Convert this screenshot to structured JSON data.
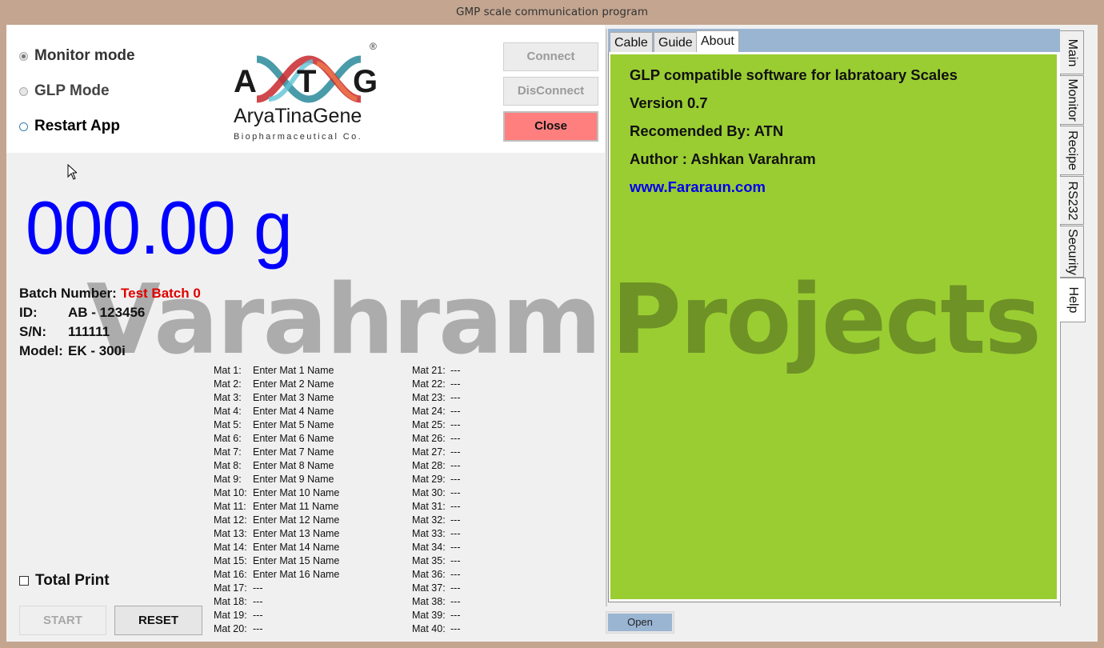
{
  "window": {
    "title": "GMP scale communication program"
  },
  "modes": [
    {
      "label": "Monitor mode",
      "checked": true
    },
    {
      "label": "GLP Mode",
      "checked": false
    },
    {
      "label": "Restart App",
      "checked": false
    }
  ],
  "logo": {
    "letters": "AXTXG",
    "registered": "®",
    "name": "AryaTinaGene",
    "subtitle": "Biopharmaceutical Co."
  },
  "buttons": {
    "connect": "Connect",
    "disconnect": "DisConnect",
    "close": "Close",
    "start": "START",
    "reset": "RESET",
    "open": "Open"
  },
  "weight": {
    "display": "000.00 g"
  },
  "info": {
    "batch_label": "Batch Number:",
    "batch_value": "Test Batch 0",
    "id_label": "ID:",
    "id_value": "AB - 123456",
    "sn_label": "S/N:",
    "sn_value": "111111",
    "model_label": "Model:",
    "model_value": "EK - 300i"
  },
  "materials_col1": [
    {
      "key": "Mat 1:",
      "value": "Enter Mat 1 Name"
    },
    {
      "key": "Mat 2:",
      "value": "Enter Mat 2 Name"
    },
    {
      "key": "Mat 3:",
      "value": "Enter Mat 3 Name"
    },
    {
      "key": "Mat 4:",
      "value": "Enter Mat 4 Name"
    },
    {
      "key": "Mat 5:",
      "value": "Enter Mat 5 Name"
    },
    {
      "key": "Mat 6:",
      "value": "Enter Mat 6 Name"
    },
    {
      "key": "Mat 7:",
      "value": "Enter Mat 7 Name"
    },
    {
      "key": "Mat 8:",
      "value": "Enter Mat 8 Name"
    },
    {
      "key": "Mat 9:",
      "value": "Enter Mat 9 Name"
    },
    {
      "key": "Mat 10:",
      "value": "Enter Mat 10 Name"
    },
    {
      "key": "Mat 11:",
      "value": "Enter Mat 11 Name"
    },
    {
      "key": "Mat 12:",
      "value": "Enter Mat 12 Name"
    },
    {
      "key": "Mat 13:",
      "value": "Enter Mat 13 Name"
    },
    {
      "key": "Mat 14:",
      "value": "Enter Mat 14 Name"
    },
    {
      "key": "Mat 15:",
      "value": "Enter Mat 15 Name"
    },
    {
      "key": "Mat 16:",
      "value": "Enter Mat 16 Name"
    },
    {
      "key": "Mat 17:",
      "value": "---"
    },
    {
      "key": "Mat 18:",
      "value": "---"
    },
    {
      "key": "Mat 19:",
      "value": "---"
    },
    {
      "key": "Mat 20:",
      "value": "---"
    }
  ],
  "materials_col2": [
    {
      "key": "Mat 21:",
      "value": "---"
    },
    {
      "key": "Mat 22:",
      "value": "---"
    },
    {
      "key": "Mat 23:",
      "value": "---"
    },
    {
      "key": "Mat 24:",
      "value": "---"
    },
    {
      "key": "Mat 25:",
      "value": "---"
    },
    {
      "key": "Mat 26:",
      "value": "---"
    },
    {
      "key": "Mat 27:",
      "value": "---"
    },
    {
      "key": "Mat 28:",
      "value": "---"
    },
    {
      "key": "Mat 29:",
      "value": "---"
    },
    {
      "key": "Mat 30:",
      "value": "---"
    },
    {
      "key": "Mat 31:",
      "value": "---"
    },
    {
      "key": "Mat 32:",
      "value": "---"
    },
    {
      "key": "Mat 33:",
      "value": "---"
    },
    {
      "key": "Mat 34:",
      "value": "---"
    },
    {
      "key": "Mat 35:",
      "value": "---"
    },
    {
      "key": "Mat 36:",
      "value": "---"
    },
    {
      "key": "Mat 37:",
      "value": "---"
    },
    {
      "key": "Mat 38:",
      "value": "---"
    },
    {
      "key": "Mat 39:",
      "value": "---"
    },
    {
      "key": "Mat 40:",
      "value": "---"
    }
  ],
  "total_print": {
    "label": "Total Print",
    "checked": false
  },
  "help_tabs": [
    {
      "label": "Cable",
      "active": false
    },
    {
      "label": "Guide",
      "active": false
    },
    {
      "label": "About",
      "active": true
    }
  ],
  "about": {
    "line1": "GLP compatible software for labratoary Scales",
    "line2": "Version 0.7",
    "line3": "Recomended By: ATN",
    "line4": "Author : Ashkan Varahram",
    "link": "www.Fararaun.com"
  },
  "side_tabs": [
    {
      "label": "Main",
      "active": false
    },
    {
      "label": "Monitor",
      "active": false
    },
    {
      "label": "Recipe",
      "active": false
    },
    {
      "label": "RS232",
      "active": false
    },
    {
      "label": "Security",
      "active": false
    },
    {
      "label": "Help",
      "active": true
    }
  ],
  "watermark": {
    "word1": "Varahram",
    "word2": "Projects"
  },
  "colors": {
    "accent_blue": "#0000ff",
    "batch_red": "#e00000",
    "about_green": "#9acd32",
    "close_red": "#ff7f7f",
    "tab_strip": "#9ab5d2",
    "window_frame": "#c3a590"
  }
}
